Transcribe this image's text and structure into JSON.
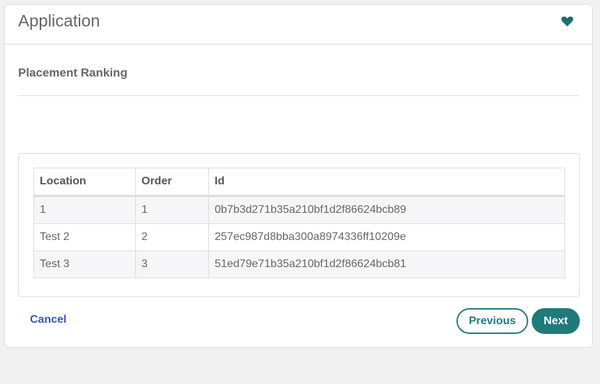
{
  "header": {
    "title": "Application",
    "favorite_icon": "heart-icon",
    "accent_color": "#1f7a7a"
  },
  "section": {
    "title": "Placement Ranking"
  },
  "table": {
    "columns": [
      "Location",
      "Order",
      "Id"
    ],
    "rows": [
      {
        "location": "1",
        "order": "1",
        "id": "0b7b3d271b35a210bf1d2f86624bcb89"
      },
      {
        "location": "Test 2",
        "order": "2",
        "id": "257ec987d8bba300a8974336ff10209e"
      },
      {
        "location": "Test 3",
        "order": "3",
        "id": "51ed79e71b35a210bf1d2f86624bcb81"
      }
    ]
  },
  "footer": {
    "cancel_label": "Cancel",
    "previous_label": "Previous",
    "next_label": "Next"
  }
}
